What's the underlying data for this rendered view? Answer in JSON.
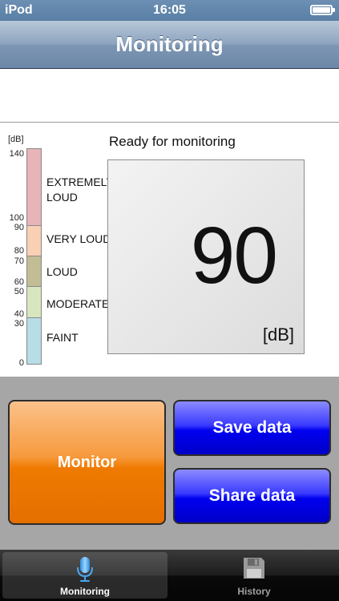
{
  "status_bar": {
    "carrier": "iPod",
    "time": "16:05",
    "battery_icon": "battery-icon"
  },
  "nav": {
    "title": "Monitoring"
  },
  "scale": {
    "unit": "[dB]",
    "ticks": [
      "140",
      "100",
      "90",
      "80",
      "70",
      "60",
      "50",
      "40",
      "30",
      "0"
    ],
    "zones": {
      "extreme_line1": "EXTREMELY",
      "extreme_line2": "LOUD",
      "very_loud": "VERY LOUD",
      "loud": "LOUD",
      "moderate": "MODERATE",
      "faint": "FAINT"
    },
    "colors": {
      "extreme": "#e8b4b8",
      "very_loud": "#f9d0b3",
      "loud": "#c2bd94",
      "moderate": "#d8e6c0",
      "faint": "#b7dde6"
    }
  },
  "meter": {
    "status": "Ready for monitoring",
    "value": "90",
    "unit": "[dB]"
  },
  "controls": {
    "monitor_label": "Monitor",
    "save_label": "Save data",
    "share_label": "Share data",
    "colors": {
      "monitor": "#ef7a00",
      "action": "#0000f0"
    }
  },
  "tabs": [
    {
      "label": "Monitoring",
      "icon": "microphone-icon",
      "selected": true
    },
    {
      "label": "History",
      "icon": "floppy-disk-icon",
      "selected": false
    }
  ]
}
